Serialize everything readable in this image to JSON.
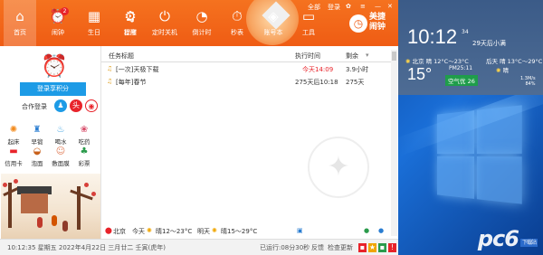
{
  "app": {
    "nav": [
      {
        "label": "首页",
        "icon": "home-icon"
      },
      {
        "label": "闹钟",
        "icon": "alarm-icon",
        "badge": "2"
      },
      {
        "label": "生日",
        "icon": "birthday-icon"
      },
      {
        "label": "提醒",
        "icon": "bell-icon"
      },
      {
        "label": "程序",
        "icon": "gear-icon"
      },
      {
        "label": "定时关机",
        "icon": "power-icon"
      },
      {
        "label": "倒计时",
        "icon": "stopwatch-icon"
      },
      {
        "label": "秒表",
        "icon": "timer-icon"
      },
      {
        "label": "账号本",
        "icon": "account-book-icon"
      },
      {
        "label": "工具",
        "icon": "toolbox-icon"
      }
    ],
    "window_controls": {
      "all": "全部",
      "login": "登录",
      "minimize": "—",
      "close": "✕"
    },
    "brand": {
      "line1": "美捷",
      "line2": "闹钟"
    },
    "sidebar": {
      "login_button": "登录享积分",
      "coop_label": "合作登录",
      "grid": [
        {
          "label": "起床",
          "icon": "sun-icon"
        },
        {
          "label": "早锻",
          "icon": "run-icon"
        },
        {
          "label": "喝水",
          "icon": "water-icon"
        },
        {
          "label": "吃药",
          "icon": "pill-icon"
        },
        {
          "label": "信用卡",
          "icon": "card-icon"
        },
        {
          "label": "泡面",
          "icon": "noodle-icon"
        },
        {
          "label": "敷面膜",
          "icon": "mask-icon"
        },
        {
          "label": "彩票",
          "icon": "lottery-icon"
        }
      ]
    },
    "list": {
      "columns": {
        "title": "任务标题",
        "time": "执行时间",
        "remain": "剩余"
      },
      "rows": [
        {
          "title": "[一次]天极下载",
          "time": "今天14:09",
          "remain": "3.9小时"
        },
        {
          "title": "[每年]春节",
          "time": "275天后10:18",
          "remain": "275天"
        }
      ]
    },
    "weather_bar": {
      "city": "北京",
      "today_label": "今天",
      "today": "晴12～23°C",
      "tomorrow_label": "明天",
      "tomorrow": "晴15～29°C",
      "aqi_label": "空气优",
      "aqi": "26"
    },
    "status_bar": {
      "datetime": "10:12:35 星期五 2022年4月22日 三月廿二 壬寅(虎年)",
      "running": "已运行:08分30秒",
      "feedback": "反馈",
      "update": "检查更新"
    }
  },
  "widget": {
    "clock": "10:12",
    "seconds": "34",
    "countdown": "29天后小满",
    "city": "北京 晴 12°C～23°C",
    "pm": "PM25:11",
    "temp": "15°",
    "aqi": "空气优 26",
    "tomorrow": "后天 晴 13°C～29°C",
    "tomorrow2": "晴",
    "wind": [
      "1.3M/s",
      "84%"
    ]
  },
  "desktop": {
    "watermark": "pc6",
    "watermark_sub": "下载站"
  },
  "colors": {
    "accent": "#ef5c14",
    "blue": "#1d9be6",
    "red": "#e8232a",
    "green": "#1f9d4b"
  }
}
